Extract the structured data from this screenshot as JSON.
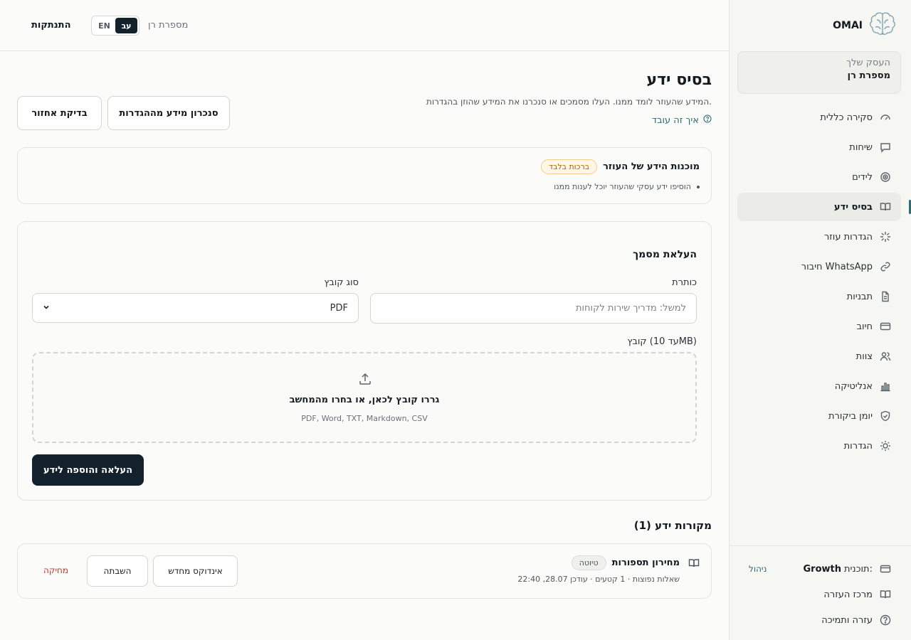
{
  "sidebar": {
    "brand": "OMAI",
    "business_label": "העסק שלך",
    "business_name": "מספרת רן",
    "items": [
      {
        "label": "סקירה כללית",
        "icon": "gauge-icon"
      },
      {
        "label": "שיחות",
        "icon": "chat-icon"
      },
      {
        "label": "לידים",
        "icon": "target-icon"
      },
      {
        "label": "בסיס ידע",
        "icon": "book-icon",
        "active": true
      },
      {
        "label": "הגדרות עוזר",
        "icon": "sparkle-icon"
      },
      {
        "label": "חיבור WhatsApp",
        "icon": "link-icon"
      },
      {
        "label": "תבניות",
        "icon": "document-icon"
      },
      {
        "label": "חיוב",
        "icon": "credit-card-icon"
      },
      {
        "label": "צוות",
        "icon": "users-icon"
      },
      {
        "label": "אנליטיקה",
        "icon": "bar-chart-icon"
      },
      {
        "label": "יומן ביקורת",
        "icon": "shield-icon"
      },
      {
        "label": "הגדרות",
        "icon": "sun-icon"
      }
    ],
    "plan_label": "תוכנית:",
    "plan_name": "Growth",
    "manage": "ניהול",
    "help_center": "מרכז העזרה",
    "support": "עזרה ותמיכה"
  },
  "topbar": {
    "logout": "התנתקות",
    "lang_en": "EN",
    "lang_he": "עב",
    "business_name": "מספרת רן"
  },
  "header": {
    "title": "בסיס ידע",
    "subtitle": "המידע שהעוזר לומד ממנו. העלו מסמכים או סנכרנו את המידע שהוזן בהגדרות.",
    "how_link": "איך זה עובד",
    "sync_button": "סנכרון מידע מההגדרות",
    "restore_button": "בדיקת אחזור"
  },
  "readiness": {
    "title": "מוכנות הידע של העוזר",
    "badge": "ברכות בלבד",
    "bullet": "הוסיפו ידע עסקי שהעוזר יוכל לענות ממנו"
  },
  "upload": {
    "title": "העלאת מסמך",
    "title_label": "כותרת",
    "title_placeholder": "למשל: מדריך שירות לקוחות",
    "type_label": "סוג קובץ",
    "type_value": "PDF",
    "file_label": "קובץ (עד 10MB)",
    "drop_main": "גררו קובץ לכאן, או בחרו מהמחשב",
    "drop_sub": "PDF, Word, TXT, Markdown, CSV",
    "submit": "העלאה והוספה לידע"
  },
  "sources": {
    "title": "מקורות ידע (1)",
    "items": [
      {
        "name": "מחירון תספורות",
        "badge": "טיוטה",
        "meta": "שאלות נפוצות · 1 קטעים · עודכן 28.07, 22:40",
        "reindex": "אינדוקס מחדש",
        "disable": "השבתה",
        "delete": "מחיקה"
      }
    ]
  }
}
